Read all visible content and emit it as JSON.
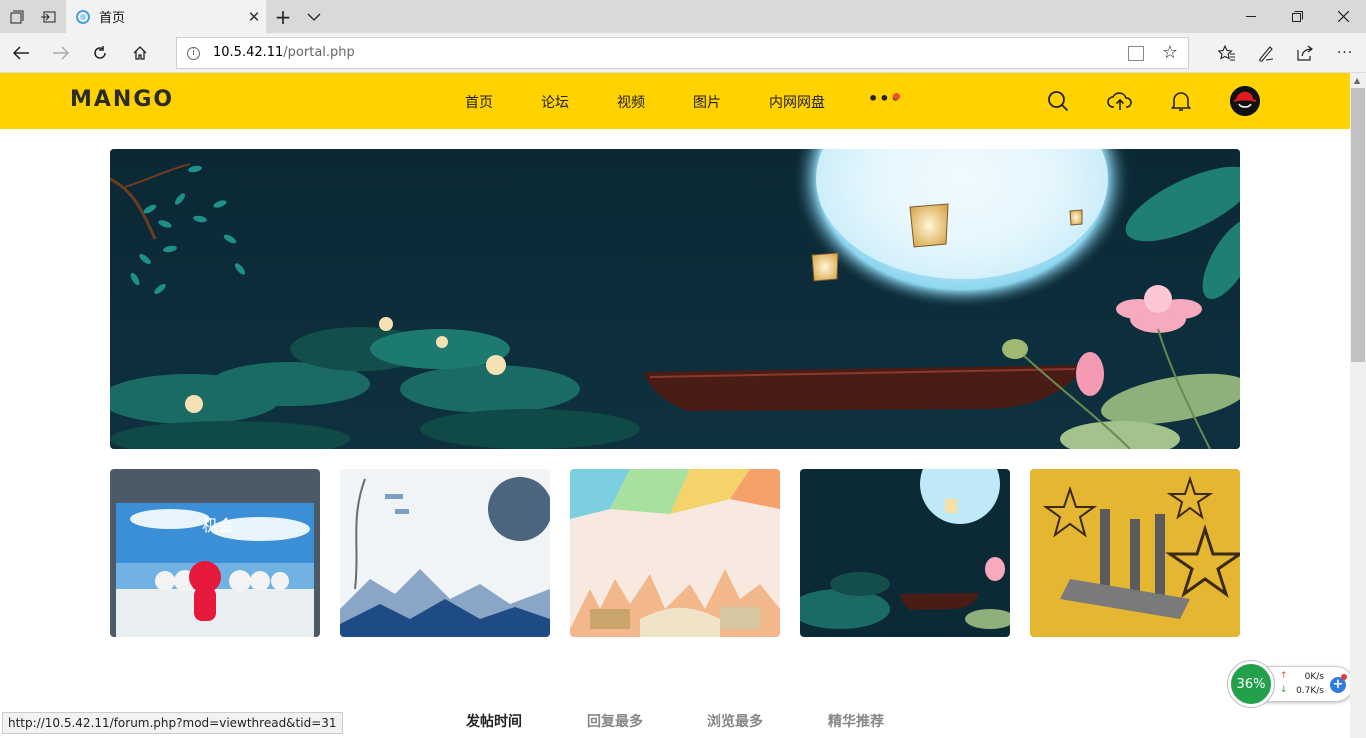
{
  "browser": {
    "tab_title": "首页",
    "url_host": "10.5.42.11",
    "url_path": "/portal.php"
  },
  "site": {
    "logo": "MANGO",
    "nav": [
      "首页",
      "论坛",
      "视频",
      "图片",
      "内网网盘"
    ],
    "more": "•••",
    "icons": [
      "search-icon",
      "upload-icon",
      "bell-icon",
      "avatar"
    ]
  },
  "content": {
    "tabs": [
      "发帖时间",
      "回复最多",
      "浏览最多",
      "精华推荐"
    ],
    "thumb1_text": "机会"
  },
  "status_bar": {
    "url": "http://10.5.42.11/forum.php?mod=viewthread&tid=31"
  },
  "speed_widget": {
    "percent": "36%",
    "upload": "0K/s",
    "download": "0.7K/s"
  },
  "colors": {
    "header_bg": "#ffd200",
    "banner_bg": "#0c2a36"
  }
}
